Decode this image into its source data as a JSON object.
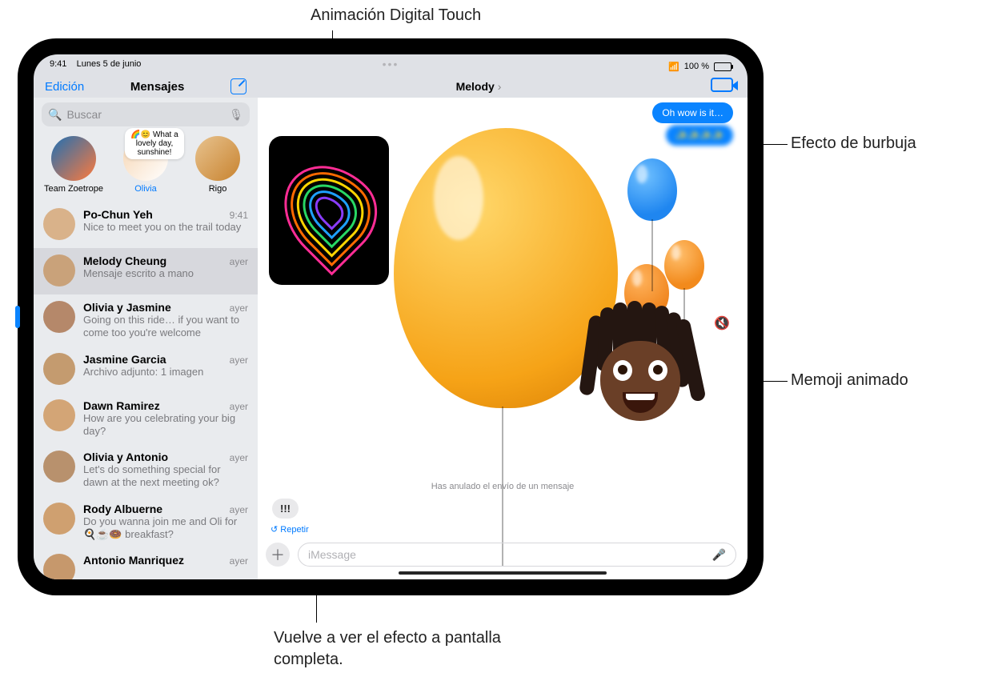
{
  "callouts": {
    "top": "Animación Digital Touch",
    "right1": "Efecto de burbuja",
    "right2": "Memoji animado",
    "bottom": "Vuelve a ver el efecto a pantalla completa."
  },
  "status": {
    "time": "9:41",
    "date": "Lunes 5 de junio",
    "battery": "100 %",
    "wifi_icon": "wifi"
  },
  "nav": {
    "edit": "Edición",
    "title": "Mensajes",
    "chat_title": "Melody",
    "chevron": "›"
  },
  "search": {
    "placeholder": "Buscar"
  },
  "pinned": [
    {
      "name": "Team Zoetrope",
      "avatar_bg": "linear-gradient(135deg,#1f6fb3,#ff7a3c)",
      "preview": ""
    },
    {
      "name": "Olivia",
      "avatar_bg": "linear-gradient(135deg,#e8c38f,#fff)",
      "preview": "🌈😊 What a lovely day, sunshine!"
    },
    {
      "name": "Rigo",
      "avatar_bg": "linear-gradient(135deg,#e8c38f,#c8832f)",
      "preview": ""
    }
  ],
  "conversations": [
    {
      "name": "Po-Chun Yeh",
      "time": "9:41",
      "preview": "Nice to meet you on the trail today",
      "avatar": "#d9b28a",
      "selected": false
    },
    {
      "name": "Melody Cheung",
      "time": "ayer",
      "preview": "Mensaje escrito a mano",
      "avatar": "#c9a27a",
      "selected": true
    },
    {
      "name": "Olivia y Jasmine",
      "time": "ayer",
      "preview": "Going on this ride… if you want to come too you're welcome",
      "avatar": "#b5886a",
      "selected": false
    },
    {
      "name": "Jasmine Garcia",
      "time": "ayer",
      "preview": "Archivo adjunto: 1 imagen",
      "avatar": "#c49b6f",
      "selected": false
    },
    {
      "name": "Dawn Ramirez",
      "time": "ayer",
      "preview": "How are you celebrating your big day?",
      "avatar": "#d3a576",
      "selected": false
    },
    {
      "name": "Olivia y Antonio",
      "time": "ayer",
      "preview": "Let's do something special for dawn at the next meeting ok?",
      "avatar": "#b8916d",
      "selected": false
    },
    {
      "name": "Rody Albuerne",
      "time": "ayer",
      "preview": "Do you wanna join me and Oli for 🍳☕️🍩 breakfast?",
      "avatar": "#cfa070",
      "selected": false
    },
    {
      "name": "Antonio Manriquez",
      "time": "ayer",
      "preview": "",
      "avatar": "#c6986c",
      "selected": false
    }
  ],
  "chat": {
    "sent1": "Oh wow is it…",
    "sent2_hidden": "✨✨✨✨",
    "system_text": "Has anulado el envío de un mensaje",
    "reply": "!!!",
    "replay": "↺ Repetir",
    "input_placeholder": "iMessage",
    "plus": "＋",
    "mic": "🎤",
    "mute": "🔇"
  },
  "heart_colors": [
    "#ff2d95",
    "#ff6a00",
    "#ffd400",
    "#28d764",
    "#1ea0ff",
    "#8a3cff"
  ]
}
